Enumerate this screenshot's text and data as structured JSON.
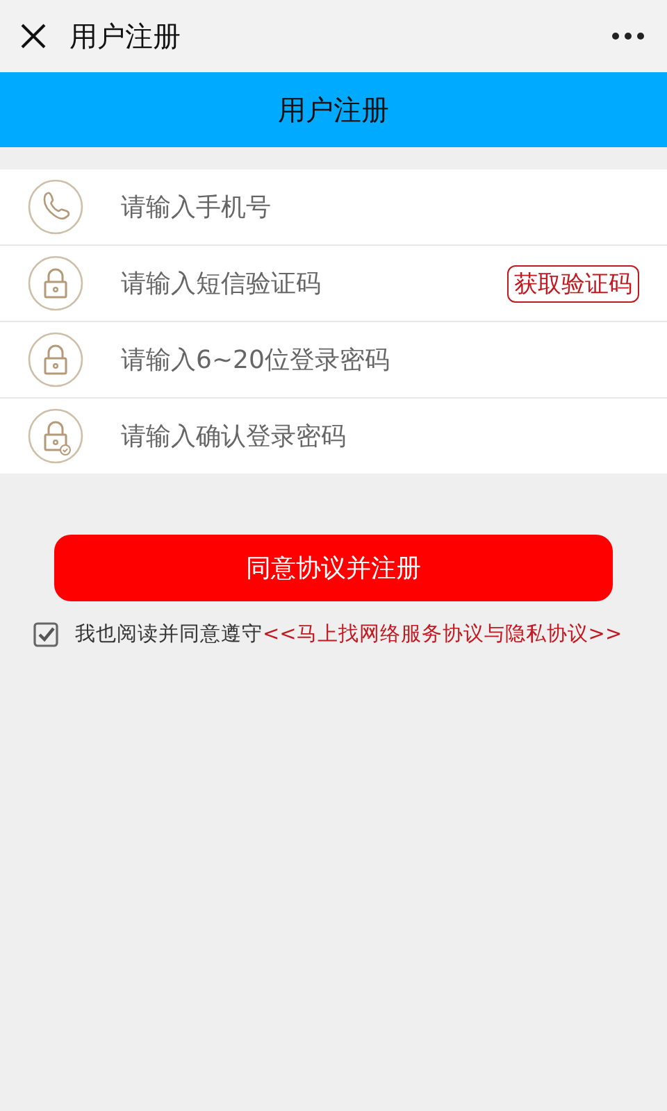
{
  "top_bar": {
    "title": "用户注册"
  },
  "header": {
    "title": "用户注册"
  },
  "fields": [
    {
      "kind": "phone",
      "placeholder": "请输入手机号"
    },
    {
      "kind": "lock",
      "placeholder": "请输入短信验证码",
      "button": "获取验证码"
    },
    {
      "kind": "lock",
      "placeholder": "请输入6~20位登录密码"
    },
    {
      "kind": "lock-check",
      "placeholder": "请输入确认登录密码"
    }
  ],
  "submit": "同意协议并注册",
  "agreement": {
    "checked": true,
    "text": "我也阅读并同意遵守",
    "link": "<<马上找网络服务协议与隐私协议>>"
  }
}
